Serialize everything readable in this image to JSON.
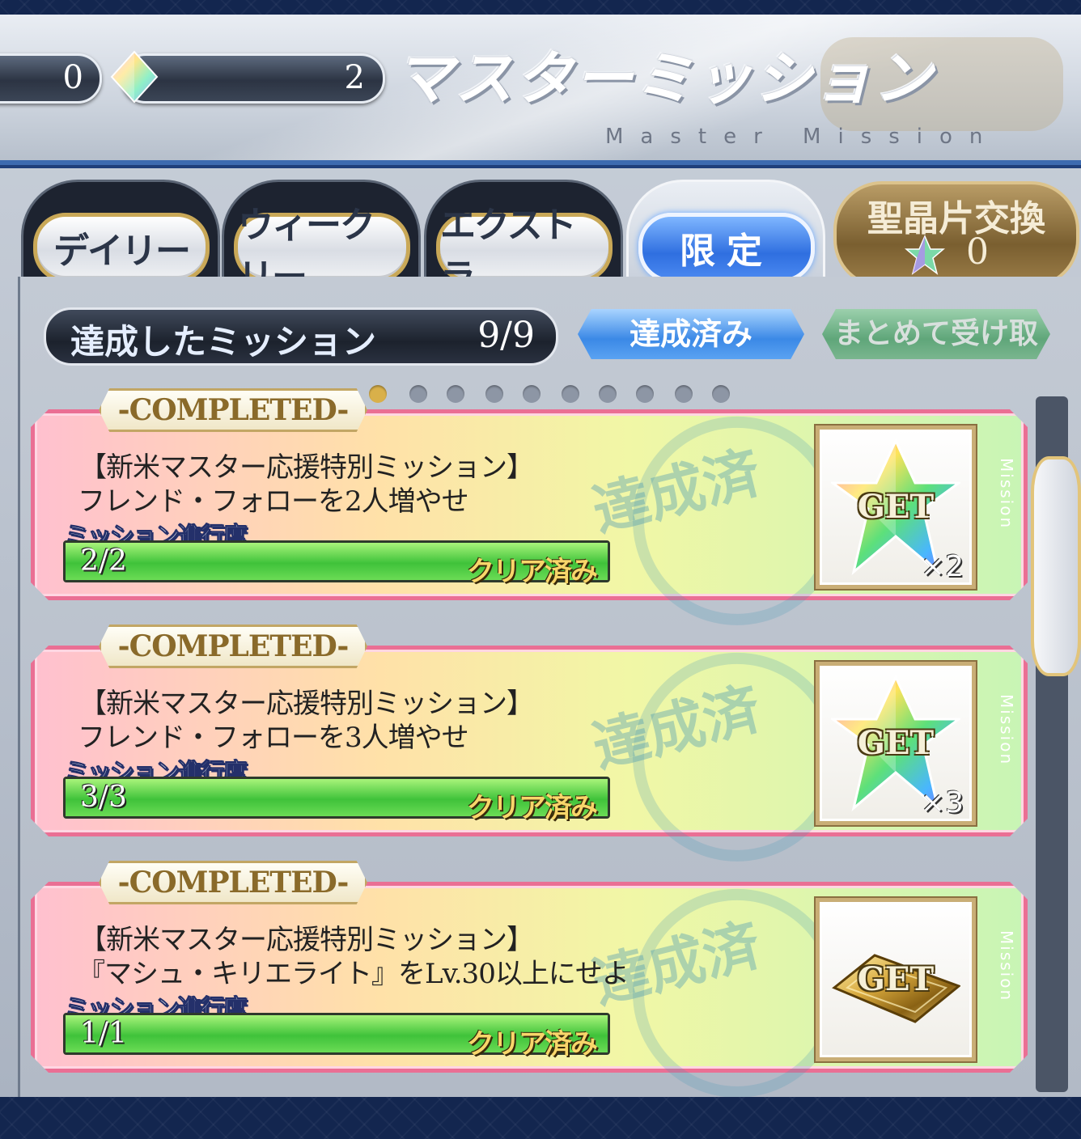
{
  "header": {
    "counter_left": "0",
    "counter_right": "2",
    "title": "マスターミッション",
    "subtitle": "Master Mission"
  },
  "tabs": [
    {
      "label": "デイリー",
      "active": false
    },
    {
      "label": "ウィークリー",
      "active": false
    },
    {
      "label": "エクストラ",
      "active": false
    },
    {
      "label": "限定",
      "active": true
    }
  ],
  "exchange": {
    "label": "聖晶片交換",
    "count": "0",
    "icon": "saint-quartz-fragment-icon"
  },
  "summary": {
    "label": "達成したミッション",
    "count": "9/9",
    "filter_label": "達成済み",
    "claim_all_label": "まとめて受け取る"
  },
  "missions": [
    {
      "tag": "-COMPLETED-",
      "stamp": "達成済",
      "title": "【新米マスター応援特別ミッション】",
      "description": "フレンド・フォローを2人増やせ",
      "progress_label": "ミッション進行度",
      "progress_text": "2/2",
      "progress_fraction": 1.0,
      "status": "クリア済み",
      "reward_label": "GET",
      "reward_icon": "saint-quartz-icon",
      "reward_qty": "×2",
      "side_label": "Mission"
    },
    {
      "tag": "-COMPLETED-",
      "stamp": "達成済",
      "title": "【新米マスター応援特別ミッション】",
      "description": "フレンド・フォローを3人増やせ",
      "progress_label": "ミッション進行度",
      "progress_text": "3/3",
      "progress_fraction": 1.0,
      "status": "クリア済み",
      "reward_label": "GET",
      "reward_icon": "saint-quartz-icon",
      "reward_qty": "×3",
      "side_label": "Mission"
    },
    {
      "tag": "-COMPLETED-",
      "stamp": "達成済",
      "title": "【新米マスター応援特別ミッション】",
      "description": "『マシュ・キリエライト』をLv.30以上にせよ",
      "progress_label": "ミッション進行度",
      "progress_text": "1/1",
      "progress_fraction": 1.0,
      "status": "クリア済み",
      "reward_label": "GET",
      "reward_icon": "gold-ticket-icon",
      "reward_qty": "",
      "side_label": "Mission"
    }
  ],
  "colors": {
    "accent_blue": "#2f6fe0",
    "card_border": "#ea6f94",
    "progress_green": "#3fc23a",
    "gold": "#c9ae76"
  }
}
